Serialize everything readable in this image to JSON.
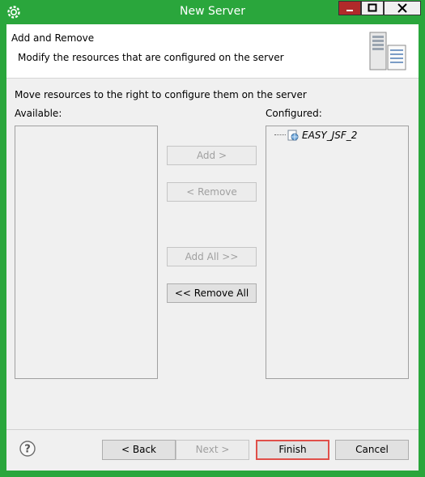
{
  "window": {
    "title": "New Server",
    "icons": {
      "app": "eclipse-gear-icon",
      "minimize": "minimize-icon",
      "maximize": "maximize-icon",
      "close": "close-icon"
    },
    "colors": {
      "frame": "#2aa63c",
      "minimize_bg": "#b12a2a",
      "finish_highlight": "#e0504a"
    }
  },
  "header": {
    "title": "Add and Remove",
    "description": "Modify the resources that are configured on the server",
    "icon": "server-icon"
  },
  "main": {
    "instruction": "Move resources to the right to configure them on the server",
    "available": {
      "label": "Available:",
      "items": []
    },
    "configured": {
      "label": "Configured:",
      "items": [
        {
          "label": "EASY_JSF_2",
          "icon": "web-module-icon"
        }
      ]
    },
    "buttons": {
      "add": "Add >",
      "remove": "< Remove",
      "add_all": "Add All >>",
      "remove_all": "<< Remove All"
    }
  },
  "footer": {
    "help_icon": "help-icon",
    "back": "< Back",
    "next": "Next >",
    "finish": "Finish",
    "cancel": "Cancel"
  }
}
